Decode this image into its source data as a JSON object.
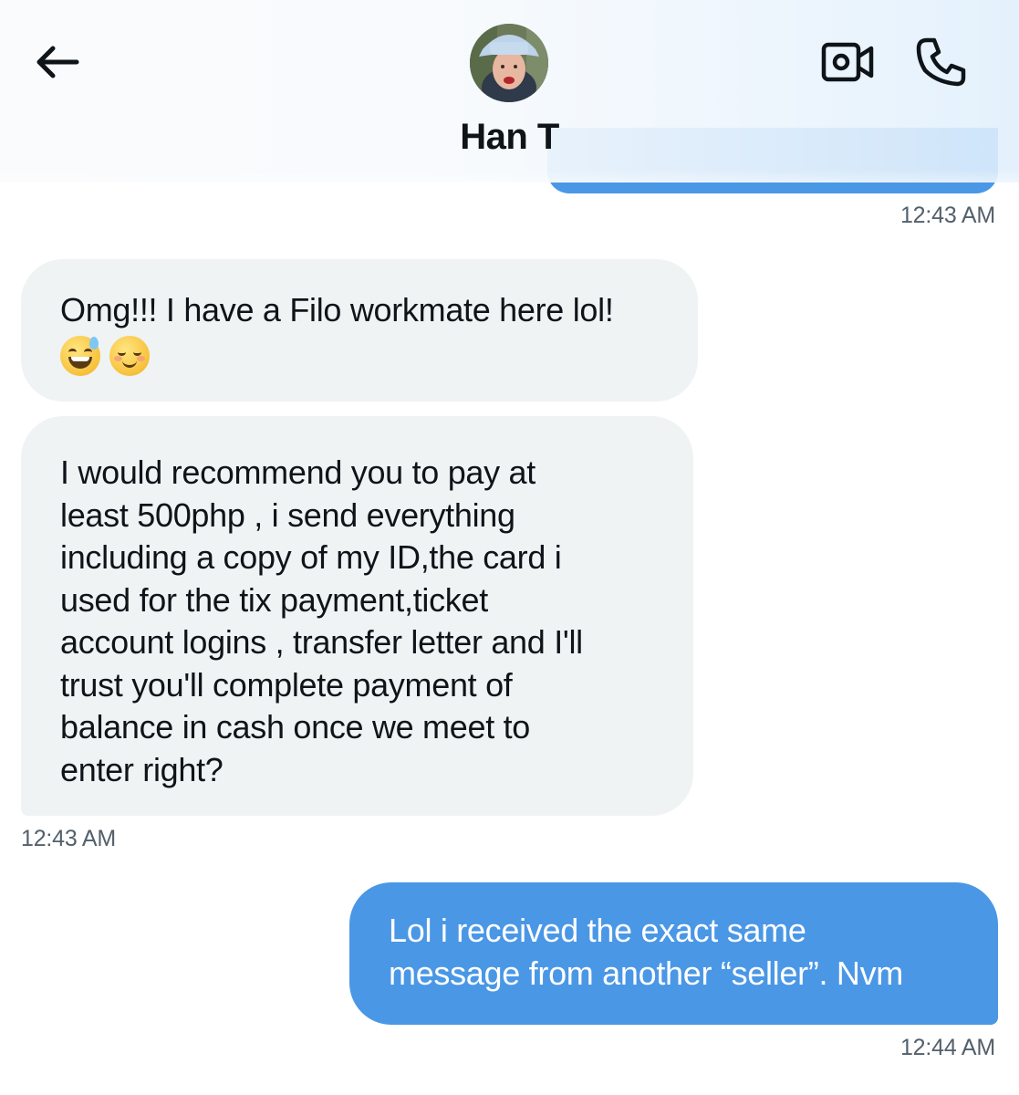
{
  "header": {
    "contact_name": "Han T",
    "back_icon": "arrow-left-icon",
    "video_icon": "video-camera-icon",
    "call_icon": "phone-icon"
  },
  "conversation": {
    "previous_sent_timestamp": "12:43 AM",
    "messages": [
      {
        "direction": "received",
        "lines": [
          "Omg!!! I have a Filo workmate here lol!"
        ],
        "emojis": [
          "grinning-face-with-sweat",
          "smiling-face"
        ]
      },
      {
        "direction": "received",
        "lines": [
          "I would recommend you to pay at",
          "least  500php  ,  i send everything",
          "including a copy of my ID,the card i",
          "used for the tix payment,ticket",
          "account logins , transfer letter and I'll",
          "trust you'll complete payment of",
          "balance in cash once we meet to",
          "enter right?"
        ],
        "timestamp": "12:43 AM"
      },
      {
        "direction": "sent",
        "lines": [
          "Lol i received the exact same",
          "message from another “seller”. Nvm"
        ],
        "timestamp": "12:44 AM"
      }
    ]
  },
  "colors": {
    "sent_bubble": "#4a97e6",
    "received_bubble": "#eff3f4",
    "text_primary": "#0f1419",
    "timestamp": "#53606c"
  }
}
